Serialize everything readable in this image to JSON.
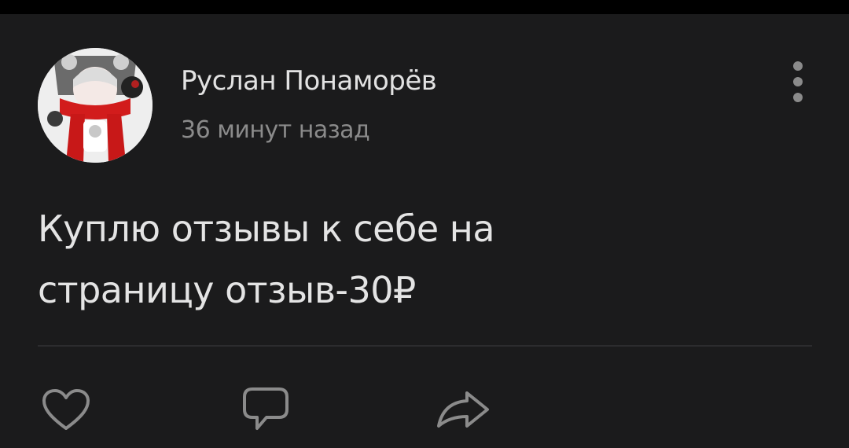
{
  "post": {
    "author_name": "Руслан Понаморёв",
    "time": "36 минут назад",
    "text_lines": [
      "Куплю отзывы к себе на",
      "страницу отзыв-30₽"
    ]
  },
  "icons": {
    "avatar": "user-avatar",
    "more": "vertical-dots-icon",
    "like": "heart-icon",
    "comment": "speech-bubble-icon",
    "share": "share-arrow-icon"
  },
  "colors": {
    "background": "#1b1b1c",
    "primary_text": "#e2e2e2",
    "secondary_text": "#8b8b8b",
    "icon": "#8b8b8b",
    "divider": "#2c2c2e"
  }
}
